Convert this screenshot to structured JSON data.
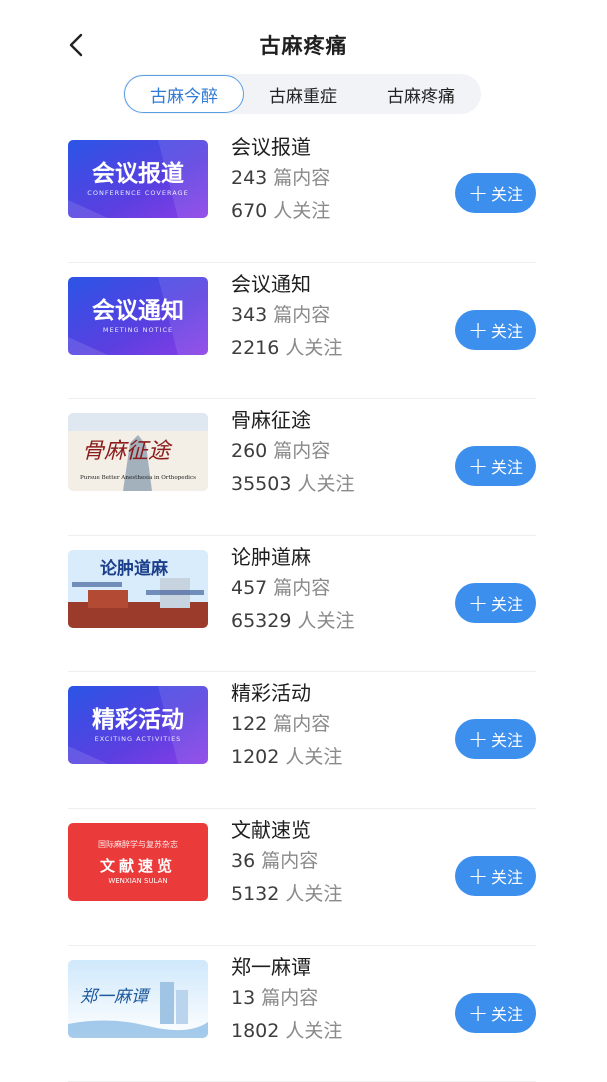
{
  "header": {
    "title": "古麻疼痛"
  },
  "tabs": [
    {
      "label": "古麻今醉"
    },
    {
      "label": "古麻重症"
    },
    {
      "label": "古麻疼痛"
    }
  ],
  "stat_units": {
    "content": "篇内容",
    "followers": "人关注"
  },
  "follow_label": "关注",
  "items": [
    {
      "name": "会议报道",
      "content_count": "243",
      "followers": "670",
      "thumb": {
        "main": "会议报道",
        "sub": "CONFERENCE COVERAGE",
        "style": "purple"
      }
    },
    {
      "name": "会议通知",
      "content_count": "343",
      "followers": "2216",
      "thumb": {
        "main": "会议通知",
        "sub": "MEETING NOTICE",
        "style": "purple"
      }
    },
    {
      "name": "骨麻征途",
      "content_count": "260",
      "followers": "35503",
      "thumb": {
        "main": "骨麻征途",
        "sub": "Pursue Better Anesthesia in Orthopedics",
        "style": "ink"
      }
    },
    {
      "name": "论肿道麻",
      "content_count": "457",
      "followers": "65329",
      "thumb": {
        "main": "论肿道麻",
        "sub": "",
        "style": "campus"
      }
    },
    {
      "name": "精彩活动",
      "content_count": "122",
      "followers": "1202",
      "thumb": {
        "main": "精彩活动",
        "sub": "EXCITING ACTIVITIES",
        "style": "purple"
      }
    },
    {
      "name": "文献速览",
      "content_count": "36",
      "followers": "5132",
      "thumb": {
        "main": "文献速览",
        "sub": "WENXIAN SULAN",
        "top": "国际麻醉学与复苏杂志",
        "style": "red"
      }
    },
    {
      "name": "郑一麻谭",
      "content_count": "13",
      "followers": "1802",
      "thumb": {
        "main": "郑一麻谭",
        "sub": "",
        "style": "sky"
      }
    }
  ],
  "colors": {
    "accent": "#3d8fee",
    "tab_active": "#2f7ad6"
  },
  "icons": {
    "back": "chevron-left-icon",
    "follow": "plus-icon"
  }
}
